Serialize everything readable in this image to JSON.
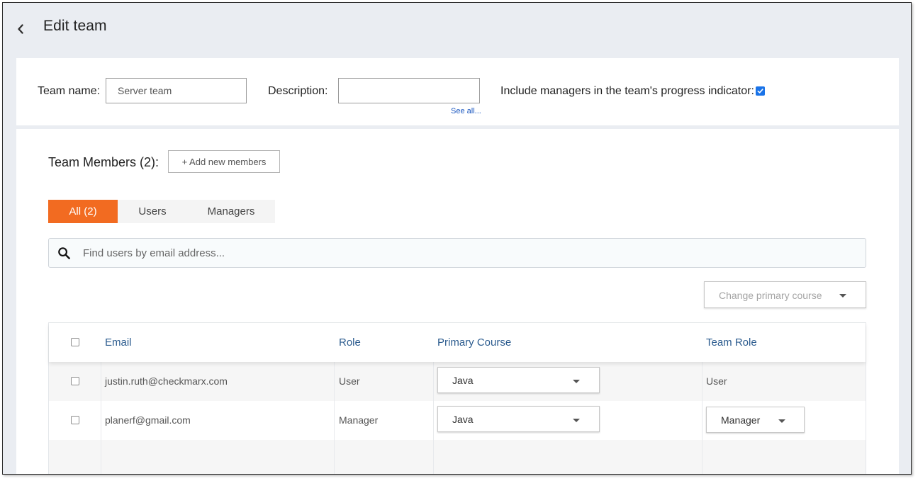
{
  "header": {
    "title": "Edit team"
  },
  "team_form": {
    "name_label": "Team name:",
    "name_value": "Server team",
    "description_label": "Description:",
    "description_value": "",
    "see_all": "See all...",
    "include_managers_label": "Include managers in the team's progress indicator:",
    "include_managers_checked": true
  },
  "members": {
    "title": "Team Members (2):",
    "add_button": "+ Add new members",
    "tabs": [
      {
        "label": "All (2)",
        "active": true
      },
      {
        "label": "Users",
        "active": false
      },
      {
        "label": "Managers",
        "active": false
      }
    ],
    "search_placeholder": "Find users by email address...",
    "change_course_label": "Change primary course"
  },
  "table": {
    "columns": [
      "Email",
      "Role",
      "Primary Course",
      "Team Role"
    ],
    "rows": [
      {
        "email": "justin.ruth@checkmarx.com",
        "role": "User",
        "primary_course": "Java",
        "team_role": "User"
      },
      {
        "email": "planerf@gmail.com",
        "role": "Manager",
        "primary_course": "Java",
        "team_role": "Manager"
      }
    ]
  },
  "colors": {
    "accent": "#f26b21",
    "link": "#1a57c0",
    "header_text": "#2c5c8f",
    "checkbox": "#1a73e8"
  },
  "icons": {
    "back": "chevron-left-icon",
    "search": "search-icon",
    "dropdown": "caret-down-icon"
  }
}
